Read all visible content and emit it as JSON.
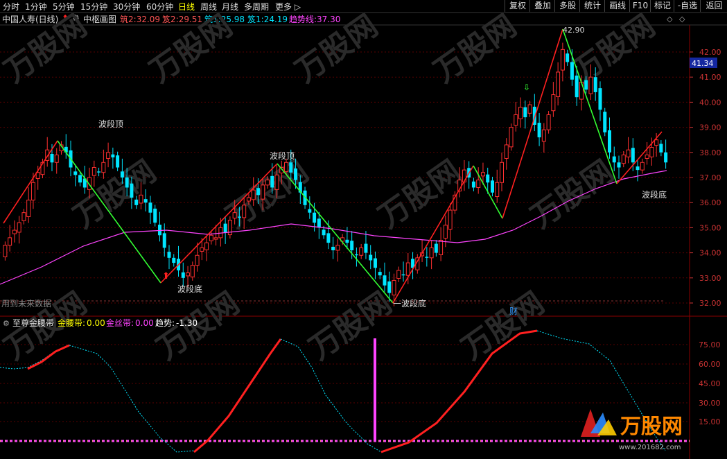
{
  "toolbar": {
    "periods": [
      "分时",
      "1分钟",
      "5分钟",
      "15分钟",
      "30分钟",
      "60分钟",
      "日线",
      "周线",
      "月线",
      "多周期",
      "更多"
    ],
    "active_period": "日线",
    "right_buttons": [
      "复权",
      "叠加",
      "多股",
      "统计",
      "画线",
      "F10",
      "标记",
      "-自选",
      "返回"
    ]
  },
  "info": {
    "stock": "中国人寿(日线)",
    "indicator": "中枢画图",
    "items": [
      {
        "label": "筑2:",
        "value": "32.09",
        "color": "#ff5555"
      },
      {
        "label": "笈2:",
        "value": "29.51",
        "color": "#ff5555"
      },
      {
        "label": "筑1:",
        "value": "25.98",
        "color": "#00e5ff"
      },
      {
        "label": "笈1:",
        "value": "24.19",
        "color": "#00e5ff"
      },
      {
        "label": "趋势线:",
        "value": "37.30",
        "color": "#ff44ff"
      }
    ]
  },
  "annotations": {
    "wave_top_1": "波段顶",
    "wave_top_2": "波段顶",
    "wave_bottom_1": "波段底",
    "wave_bottom_2": "波段底",
    "wave_bottom_3": "一波段底",
    "high_label": "42.90",
    "future_data": "用到未来数据",
    "cai": "财"
  },
  "price_axis": {
    "ticks": [
      42,
      41,
      40,
      39,
      38,
      37,
      36,
      35,
      34,
      33,
      32
    ],
    "current": "41.34"
  },
  "lower_panel": {
    "name": "至尊金腰带",
    "items": [
      {
        "label": "金腰带:",
        "value": "0.00",
        "color": "#ffff00"
      },
      {
        "label": "金丝带:",
        "value": "0.00",
        "color": "#ff44ff"
      },
      {
        "label": "趋势:",
        "value": "-1.30",
        "color": "#ffffff"
      }
    ],
    "ticks": [
      "75.00",
      "60.00",
      "45.00",
      "30.00",
      "15.00"
    ]
  },
  "watermark": "万股网",
  "watermark_url": "www.201682.com"
}
